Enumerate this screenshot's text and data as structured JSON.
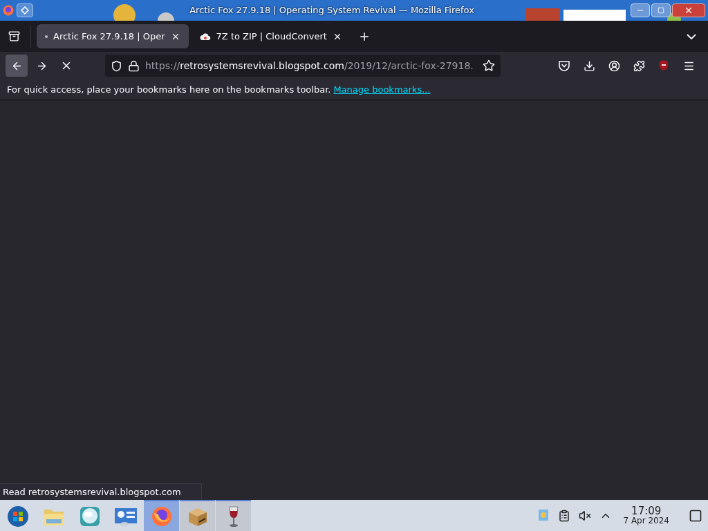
{
  "window": {
    "title": "Arctic Fox 27.9.18 | Operating System Revival — Mozilla Firefox"
  },
  "tabs": [
    {
      "title": "Arctic Fox 27.9.18 | Oper",
      "selected": true,
      "loading": true
    },
    {
      "title": "7Z to ZIP | CloudConvert",
      "selected": false,
      "loading": false
    }
  ],
  "url": {
    "scheme": "https://",
    "host": "retrosystemsrevival.blogspot.com",
    "path": "/2019/12/arctic-fox-27918."
  },
  "bookmarks_bar": {
    "message": "For quick access, place your bookmarks here on the bookmarks toolbar.",
    "link": "Manage bookmarks..."
  },
  "status": "Read retrosystemsrevival.blogspot.com",
  "taskbar": {
    "apps": [
      {
        "kind": "start",
        "selected": false,
        "open": false
      },
      {
        "kind": "folder",
        "selected": false,
        "open": false
      },
      {
        "kind": "globe",
        "selected": false,
        "open": false
      },
      {
        "kind": "monitor",
        "selected": false,
        "open": false
      },
      {
        "kind": "firefox",
        "selected": true,
        "open": true
      },
      {
        "kind": "package",
        "selected": false,
        "open": true
      },
      {
        "kind": "wine",
        "selected": false,
        "open": true
      }
    ],
    "time": "17:09",
    "date": "7 Apr 2024"
  }
}
